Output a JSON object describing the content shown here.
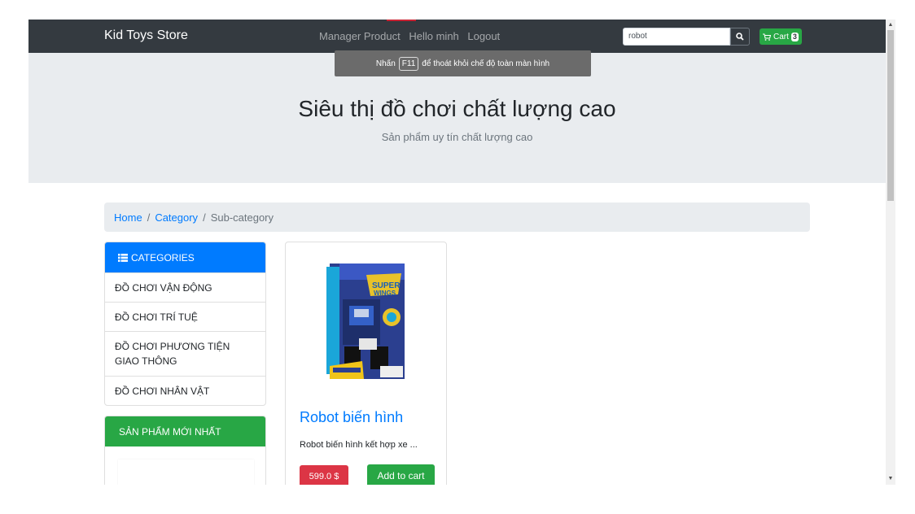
{
  "navbar": {
    "brand": "Kid Toys Store",
    "links": [
      "Manager Product",
      "Hello minh",
      "Logout"
    ],
    "search": {
      "value": "robot",
      "placeholder": ""
    },
    "cart": {
      "label": "Cart",
      "count": "3"
    }
  },
  "fullscreen_hint": {
    "prefix": "Nhấn",
    "key": "F11",
    "suffix": "để thoát khỏi chế độ toàn màn hình"
  },
  "jumbotron": {
    "title": "Siêu thị đồ chơi chất lượng cao",
    "subtitle": "Sản phẩm uy tín chất lượng cao"
  },
  "breadcrumb": {
    "home": "Home",
    "category": "Category",
    "current": "Sub-category"
  },
  "categories": {
    "header": "CATEGORIES",
    "items": [
      "ĐỒ CHƠI VẬN ĐỘNG",
      "ĐỒ CHƠI TRÍ TUỆ",
      "ĐỒ CHƠI PHƯƠNG TIỆN GIAO THÔNG",
      "ĐỒ CHƠI NHÂN VẬT"
    ]
  },
  "new_products": {
    "header": "SẢN PHẨM MỚI NHẤT"
  },
  "product": {
    "title": "Robot biến hình",
    "description": "Robot biến hình kết hợp xe ...",
    "price": "599.0 $",
    "add_to_cart": "Add to cart"
  },
  "colors": {
    "navbar": "#343a40",
    "primary": "#007bff",
    "success": "#28a745",
    "danger": "#dc3545",
    "jumbotron": "#e9ecef"
  },
  "icons": [
    "search-icon",
    "cart-icon",
    "list-icon",
    "scroll-up-icon",
    "scroll-down-icon"
  ]
}
